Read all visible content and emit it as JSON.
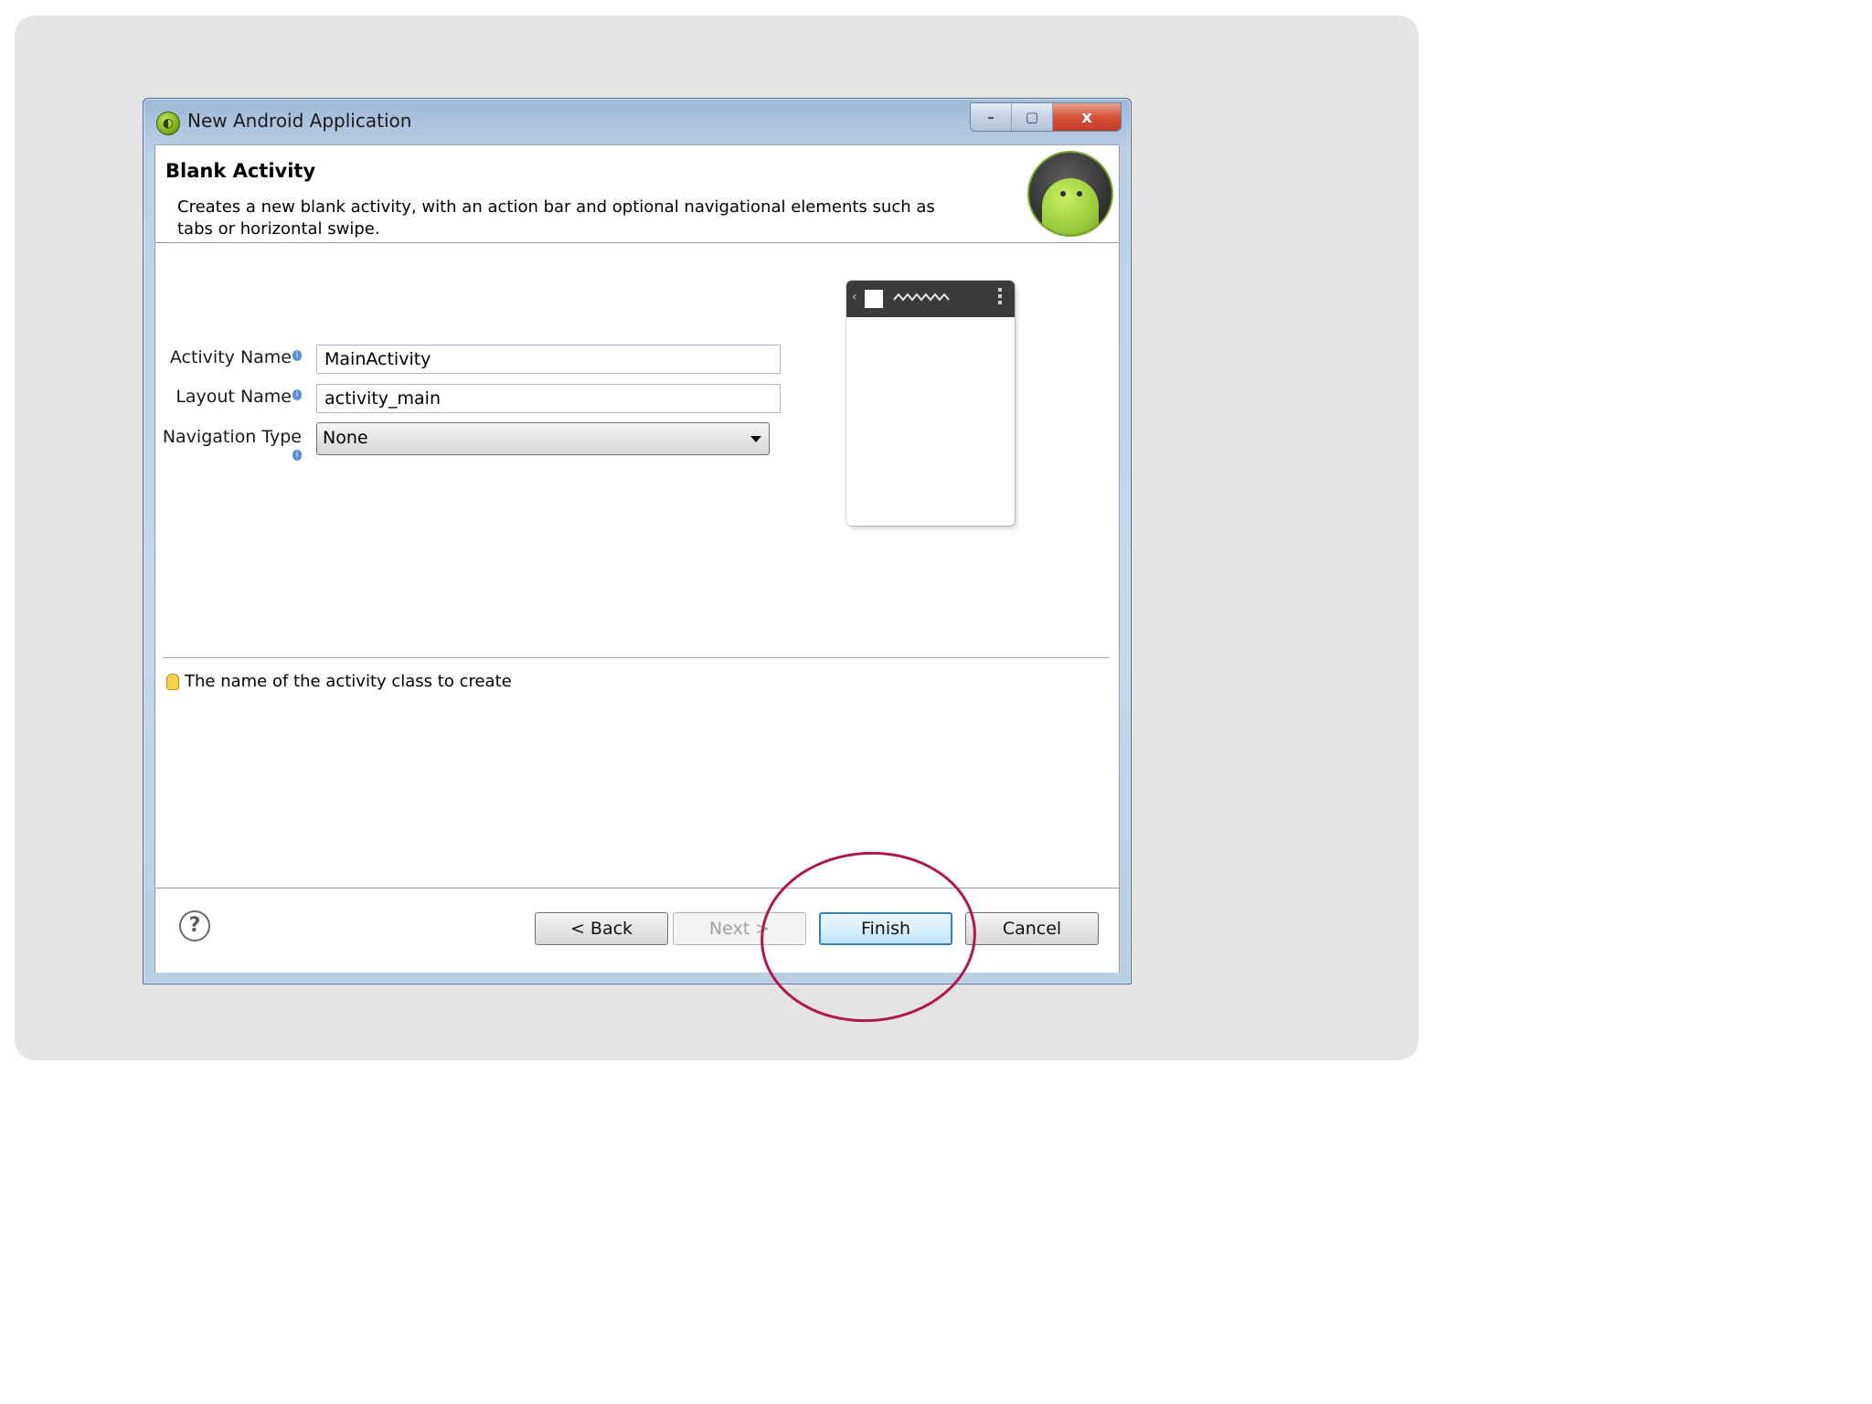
{
  "window": {
    "title": "New Android Application",
    "controls": {
      "minimize": "–",
      "maximize": "▢",
      "close": "x"
    }
  },
  "header": {
    "title": "Blank Activity",
    "description": "Creates a new blank activity, with an action bar and optional navigational elements such as tabs or horizontal swipe."
  },
  "form": {
    "activity_name": {
      "label": "Activity Name",
      "value": "MainActivity"
    },
    "layout_name": {
      "label": "Layout Name",
      "value": "activity_main"
    },
    "navigation_type": {
      "label": "Navigation Type",
      "value": "None"
    }
  },
  "hint": {
    "text": "The name of the activity class to create"
  },
  "footer": {
    "help": "?",
    "back": "< Back",
    "next": "Next >",
    "finish": "Finish",
    "cancel": "Cancel"
  },
  "colors": {
    "annotation": "#b0174f",
    "accent_blue": "#3c7fb1",
    "android_green": "#97c93a"
  },
  "icons": {
    "app": "android-adt-icon",
    "hint": "lightbulb-icon",
    "help": "question-mark-icon",
    "info": "info-icon"
  }
}
